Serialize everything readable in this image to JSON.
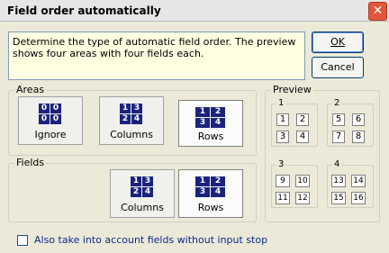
{
  "title": "Field order automatically",
  "close_symbol": "✕",
  "description": "Determine the type of automatic field order. The preview shows four areas with four fields each.",
  "buttons": {
    "ok": "OK",
    "cancel": "Cancel"
  },
  "areas": {
    "label": "Areas",
    "options": [
      {
        "label": "Ignore",
        "grid": [
          "0",
          "0",
          "0",
          "0"
        ],
        "selected": false
      },
      {
        "label": "Columns",
        "grid": [
          "1",
          "3",
          "2",
          "4"
        ],
        "selected": false
      },
      {
        "label": "Rows",
        "grid": [
          "1",
          "2",
          "3",
          "4"
        ],
        "selected": true
      }
    ]
  },
  "fields": {
    "label": "Fields",
    "options": [
      {
        "label": "Columns",
        "grid": [
          "1",
          "3",
          "2",
          "4"
        ],
        "selected": false
      },
      {
        "label": "Rows",
        "grid": [
          "1",
          "2",
          "3",
          "4"
        ],
        "selected": true
      }
    ]
  },
  "preview": {
    "label": "Preview",
    "areas": [
      {
        "label": "1",
        "cells": [
          "1",
          "2",
          "3",
          "4"
        ]
      },
      {
        "label": "2",
        "cells": [
          "5",
          "6",
          "7",
          "8"
        ]
      },
      {
        "label": "3",
        "cells": [
          "9",
          "10",
          "11",
          "12"
        ]
      },
      {
        "label": "4",
        "cells": [
          "13",
          "14",
          "15",
          "16"
        ]
      }
    ]
  },
  "checkbox": {
    "label": "Also take into account fields without input stop",
    "checked": false
  }
}
